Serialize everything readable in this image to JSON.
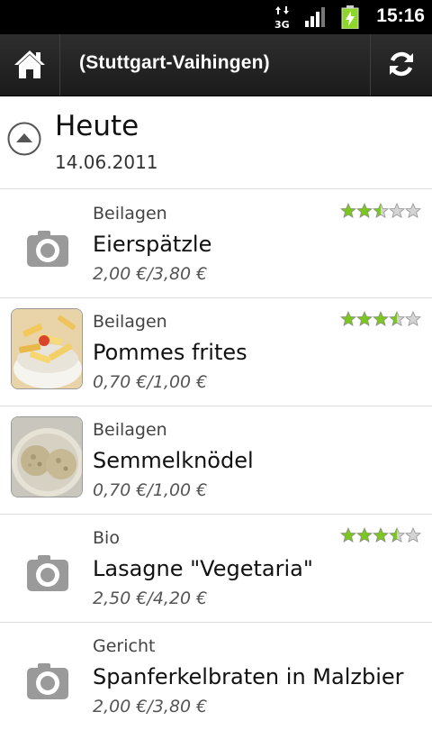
{
  "status_bar": {
    "time": "15:16",
    "network": "3G"
  },
  "action_bar": {
    "title": "(Stuttgart-Vaihingen)"
  },
  "day": {
    "title": "Heute",
    "date": "14.06.2011"
  },
  "meals": [
    {
      "category": "Beilagen",
      "name": "Eierspätzle",
      "price": "2,00 €/3,80 €",
      "image": "camera-placeholder",
      "rating": 2.5
    },
    {
      "category": "Beilagen",
      "name": "Pommes frites",
      "price": "0,70 €/1,00 €",
      "image": "photo",
      "rating": 3.5
    },
    {
      "category": "Beilagen",
      "name": "Semmelknödel",
      "price": "0,70 €/1,00 €",
      "image": "photo",
      "rating": null
    },
    {
      "category": "Bio",
      "name": "Lasagne \"Vegetaria\"",
      "price": "2,50 €/4,20 €",
      "image": "camera-placeholder",
      "rating": 3.5
    },
    {
      "category": "Gericht",
      "name": "Spanferkelbraten in Malzbier",
      "price": "2,00 €/3,80 €",
      "image": "camera-placeholder",
      "rating": null
    }
  ],
  "colors": {
    "star_filled": "#7cc620",
    "star_empty": "#d4d4d4",
    "actionbar": "#222222"
  }
}
